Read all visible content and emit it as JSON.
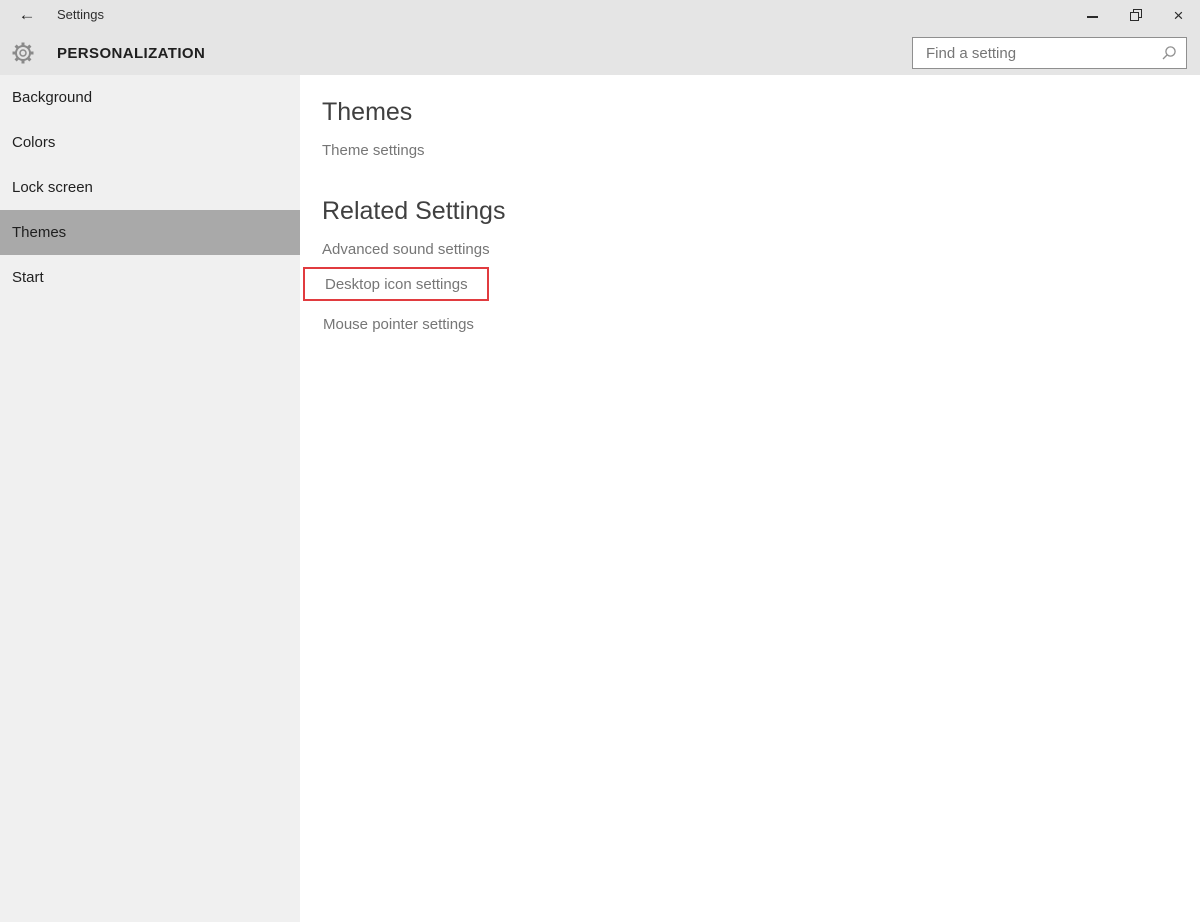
{
  "window": {
    "title": "Settings"
  },
  "icons": {
    "back": "←",
    "close": "×"
  },
  "header": {
    "title": "PERSONALIZATION",
    "search_placeholder": "Find a setting"
  },
  "sidebar": {
    "items": [
      {
        "label": "Background",
        "selected": false
      },
      {
        "label": "Colors",
        "selected": false
      },
      {
        "label": "Lock screen",
        "selected": false
      },
      {
        "label": "Themes",
        "selected": true
      },
      {
        "label": "Start",
        "selected": false
      }
    ]
  },
  "content": {
    "themes": {
      "heading": "Themes",
      "link_theme_settings": "Theme settings"
    },
    "related": {
      "heading": "Related Settings",
      "link_advanced_sound": "Advanced sound settings",
      "link_desktop_icon": "Desktop icon settings",
      "link_mouse_pointer": "Mouse pointer settings"
    }
  },
  "annotation": {
    "highlighted_item": "Desktop icon settings",
    "highlight_border_color": "#e13b3f"
  },
  "colors": {
    "chrome_bg": "#e5e5e5",
    "sidebar_bg": "#f0f0f0",
    "selected_item_bg": "#a9a9a9",
    "link_text": "#767676",
    "heading_text": "#404040",
    "search_border": "#8f8f8f"
  }
}
